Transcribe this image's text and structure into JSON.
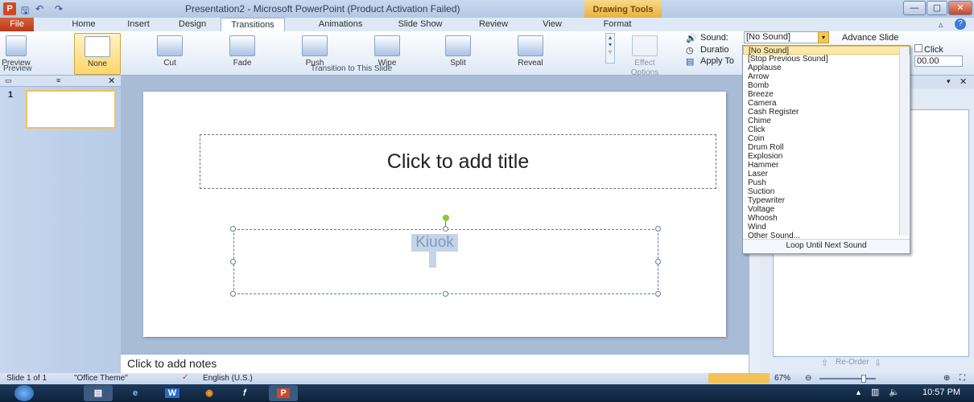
{
  "titlebar": {
    "app_icon": "P",
    "title": "Presentation2 - Microsoft PowerPoint (Product Activation Failed)",
    "contextual_tab": "Drawing Tools",
    "min": "—",
    "max": "▢",
    "close": "✕"
  },
  "tabs": [
    "File",
    "Home",
    "Insert",
    "Design",
    "Transitions",
    "Animations",
    "Slide Show",
    "Review",
    "View",
    "Format"
  ],
  "ribbon": {
    "preview": "Preview",
    "transitions": [
      "None",
      "Cut",
      "Fade",
      "Push",
      "Wipe",
      "Split",
      "Reveal"
    ],
    "effect_options": "Effect Options",
    "group_preview": "Preview",
    "group_transition": "Transition to This Slide",
    "sound_label": "Sound:",
    "sound_value": "[No Sound]",
    "duration_label": "Duratio",
    "apply_label": "Apply To",
    "advance_slide": "Advance Slide",
    "click_label": "Click",
    "timing_value": "00.00"
  },
  "sound_options": [
    "[No Sound]",
    "[Stop Previous Sound]",
    "Applause",
    "Arrow",
    "Bomb",
    "Breeze",
    "Camera",
    "Cash Register",
    "Chime",
    "Click",
    "Coin",
    "Drum Roll",
    "Explosion",
    "Hammer",
    "Laser",
    "Push",
    "Suction",
    "Typewriter",
    "Voltage",
    "Whoosh",
    "Wind",
    "Other Sound..."
  ],
  "loop_label": "Loop Until Next Sound",
  "slides_panel": {
    "slide_number": "1"
  },
  "slide": {
    "title_placeholder": "Click to add title",
    "content_text": "Kiuok"
  },
  "notes": "Click to add notes",
  "right_panel": {
    "reorder": "Re-Order"
  },
  "statusbar": {
    "slide": "Slide 1 of 1",
    "theme": "\"Office Theme\"",
    "language": "English (U.S.)",
    "zoom": "67%"
  },
  "taskbar": {
    "time": "10:57 PM",
    "word": "W",
    "ppt": "P"
  }
}
